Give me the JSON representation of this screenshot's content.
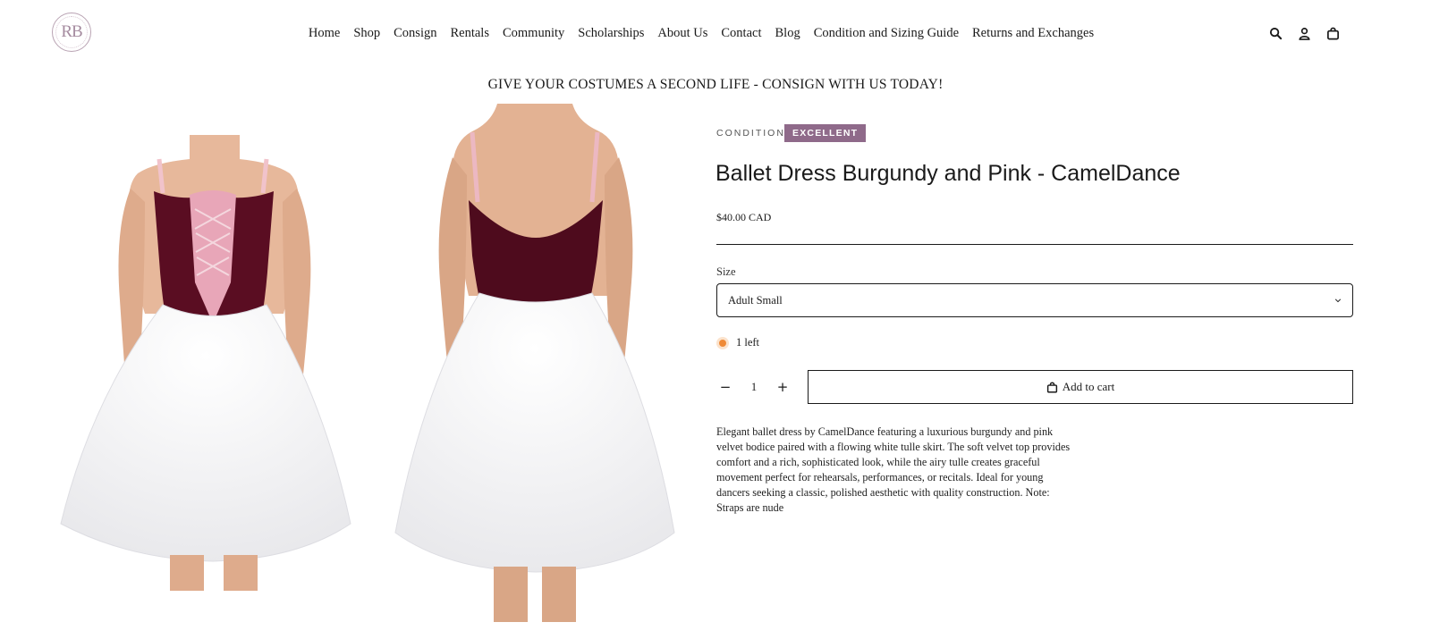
{
  "header": {
    "logo_text": "RB",
    "nav": [
      "Home",
      "Shop",
      "Consign",
      "Rentals",
      "Community",
      "Scholarships",
      "About Us",
      "Contact",
      "Blog",
      "Condition and Sizing Guide",
      "Returns and Exchanges"
    ],
    "icons": [
      "search-icon",
      "account-icon",
      "cart-icon"
    ]
  },
  "announcement": "GIVE YOUR COSTUMES A SECOND LIFE - CONSIGN WITH US TODAY!",
  "product": {
    "condition_label": "CONDITION",
    "condition_value": "EXCELLENT",
    "title": "Ballet Dress Burgundy and Pink - CamelDance",
    "price": "$40.00 CAD",
    "size_label": "Size",
    "size_selected": "Adult Small",
    "stock": "1 left",
    "quantity": "1",
    "add_to_cart": "Add to cart",
    "description": "Elegant ballet dress by CamelDance featuring a luxurious burgundy and pink velvet bodice paired with a flowing white tulle skirt. The soft velvet top provides comfort and a rich, sophisticated look, while the airy tulle creates graceful movement perfect for rehearsals, performances, or recitals. Ideal for young dancers seeking a classic, polished aesthetic with quality construction. Note: Straps are nude"
  },
  "colors": {
    "badge": "#8f6a8a",
    "stock_dot": "#ef8a37",
    "burgundy": "#5a0d22",
    "pink": "#e8a6b8"
  }
}
